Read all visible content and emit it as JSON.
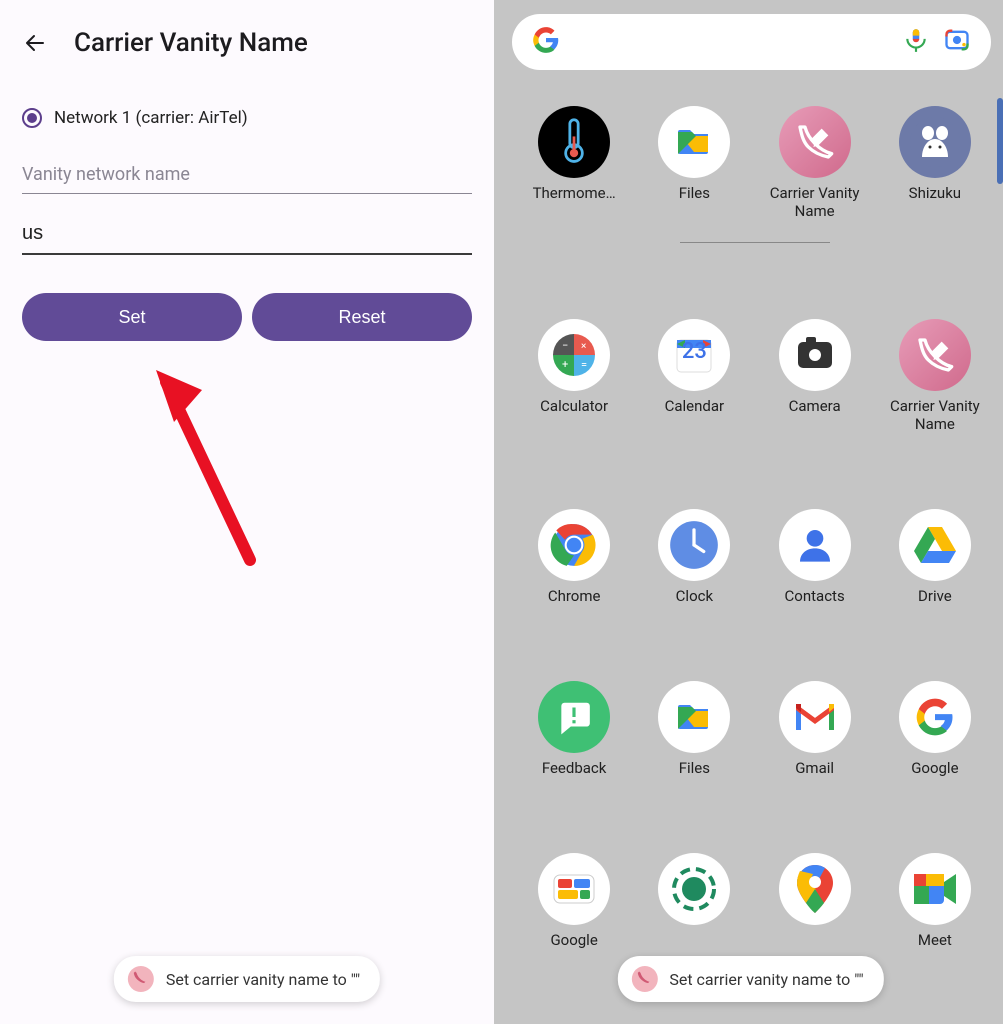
{
  "left": {
    "title": "Carrier Vanity Name",
    "radio_label": "Network 1 (carrier: AirTel)",
    "placeholder": "Vanity network name",
    "input_value": "us",
    "set_btn": "Set",
    "reset_btn": "Reset",
    "toast": "Set carrier vanity name to \"\""
  },
  "right": {
    "apps": [
      {
        "label": "Thermome…",
        "key": "thermometer"
      },
      {
        "label": "Files",
        "key": "files"
      },
      {
        "label": "Carrier Vanity Name",
        "key": "cvn"
      },
      {
        "label": "Shizuku",
        "key": "shizuku"
      },
      {
        "label": "Calculator",
        "key": "calculator"
      },
      {
        "label": "Calendar",
        "key": "calendar",
        "badge": "23"
      },
      {
        "label": "Camera",
        "key": "camera"
      },
      {
        "label": "Carrier Vanity Name",
        "key": "cvn2"
      },
      {
        "label": "Chrome",
        "key": "chrome"
      },
      {
        "label": "Clock",
        "key": "clock"
      },
      {
        "label": "Contacts",
        "key": "contacts"
      },
      {
        "label": "Drive",
        "key": "drive"
      },
      {
        "label": "Feedback",
        "key": "feedback"
      },
      {
        "label": "Files",
        "key": "files2"
      },
      {
        "label": "Gmail",
        "key": "gmail"
      },
      {
        "label": "Google",
        "key": "google"
      },
      {
        "label": "Google",
        "key": "googletv"
      },
      {
        "label": "",
        "key": "lens2"
      },
      {
        "label": "",
        "key": "maps"
      },
      {
        "label": "Meet",
        "key": "meet"
      }
    ],
    "toast": "Set carrier vanity name to \"\""
  }
}
